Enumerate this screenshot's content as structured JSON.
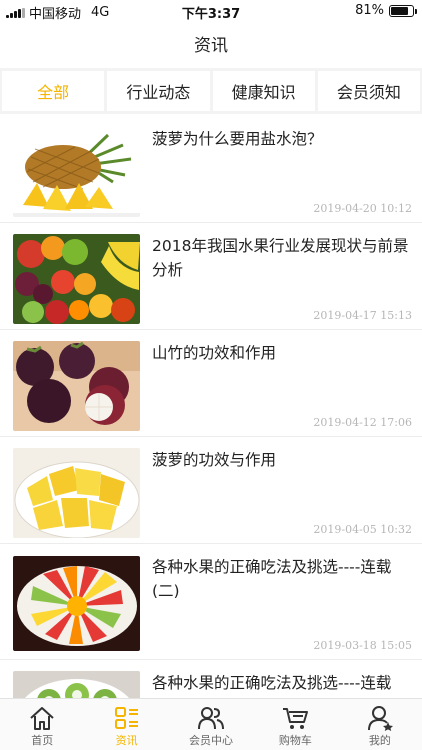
{
  "status_bar": {
    "carrier": "中国移动",
    "network": "4G",
    "time": "下午3:37",
    "battery": "81%",
    "battery_level": 0.81
  },
  "header": {
    "title": "资讯"
  },
  "tabs": [
    {
      "label": "全部",
      "active": true
    },
    {
      "label": "行业动态",
      "active": false
    },
    {
      "label": "健康知识",
      "active": false
    },
    {
      "label": "会员须知",
      "active": false
    }
  ],
  "articles": [
    {
      "title": "菠萝为什么要用盐水泡？",
      "date": "2019-04-20 10:12",
      "image": "pineapple-image"
    },
    {
      "title": "2018年我国水果行业发展现状与前景分析",
      "date": "2019-04-17 15:13",
      "image": "fruit-assortment-image"
    },
    {
      "title": "山竹的功效和作用",
      "date": "2019-04-12 17:06",
      "image": "mangosteen-image"
    },
    {
      "title": "菠萝的功效与作用",
      "date": "2019-04-05 10:32",
      "image": "pineapple-chunks-image"
    },
    {
      "title": "各种水果的正确吃法及挑选----连载(二)",
      "date": "2019-03-18 15:05",
      "image": "fruit-platter-image"
    },
    {
      "title": "各种水果的正确吃法及挑选----连载(一)",
      "date": "",
      "image": "fruit-platter-image-2"
    }
  ],
  "bottom_nav": [
    {
      "label": "首页",
      "icon": "home-icon",
      "active": false
    },
    {
      "label": "资讯",
      "icon": "news-grid-icon",
      "active": true
    },
    {
      "label": "会员中心",
      "icon": "members-icon",
      "active": false
    },
    {
      "label": "购物车",
      "icon": "cart-icon",
      "active": false
    },
    {
      "label": "我的",
      "icon": "profile-icon",
      "active": false
    }
  ],
  "colors": {
    "accent": "#f5b400",
    "text": "#222222",
    "date": "#b6b6b6",
    "divider": "#ececec"
  }
}
